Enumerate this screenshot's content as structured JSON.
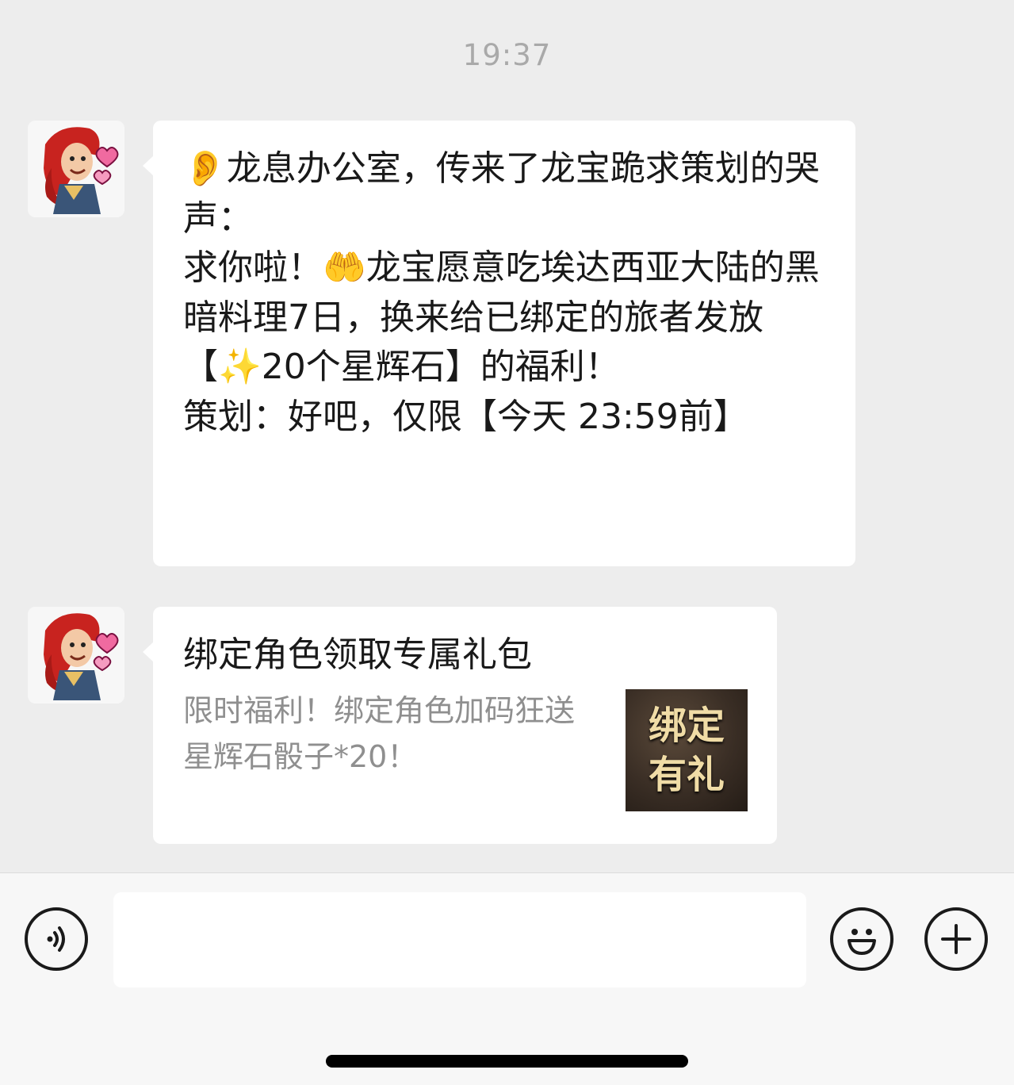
{
  "status": {
    "time": "19:37"
  },
  "messages": [
    {
      "type": "text",
      "avatar": "dragon-girl-avatar",
      "text": "👂龙息办公室，传来了龙宝跪求策划的哭声：\n求你啦！🤲龙宝愿意吃埃达西亚大陆的黑暗料理7日，换来给已绑定的旅者发放【✨20个星辉石】的福利！\n策划：好吧，仅限【今天 23:59前】"
    },
    {
      "type": "card",
      "avatar": "dragon-girl-avatar",
      "title": "绑定角色领取专属礼包",
      "description": "限时福利！绑定角色加码狂送星辉石骰子*20！",
      "thumbnail": {
        "line1": "绑定",
        "line2": "有礼"
      }
    }
  ],
  "input_bar": {
    "voice_icon": "voice-icon",
    "emoji_icon": "emoji-smile-icon",
    "plus_icon": "plus-icon",
    "placeholder": ""
  }
}
